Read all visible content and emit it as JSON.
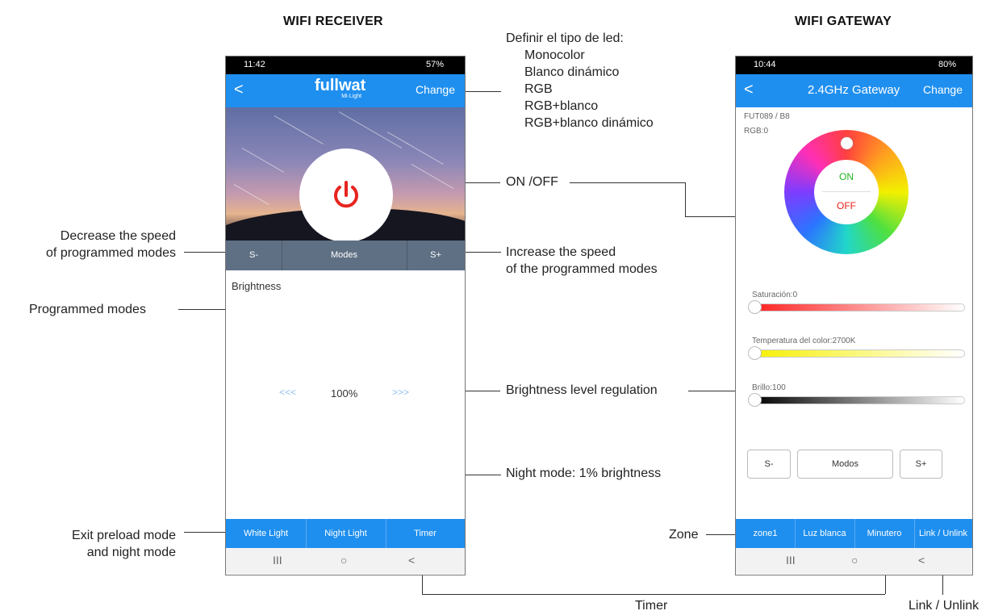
{
  "headings": {
    "left": "WIFI RECEIVER",
    "right": "WIFI GATEWAY"
  },
  "annotations": {
    "led_type_title": "Definir el tipo de led:",
    "led_types": [
      "Monocolor",
      "Blanco dinámico",
      "RGB",
      "RGB+blanco",
      "RGB+blanco dinámico"
    ],
    "on_off": "ON /OFF",
    "decrease_speed_1": "Decrease the speed",
    "decrease_speed_2": "of programmed modes",
    "increase_speed_1": "Increase the speed",
    "increase_speed_2": "of the programmed modes",
    "programmed_modes": "Programmed modes",
    "brightness_regulation": "Brightness level regulation",
    "night_mode": "Night mode: 1% brightness",
    "exit_preload_1": "Exit preload mode",
    "exit_preload_2": "and night mode",
    "zone": "Zone",
    "timer": "Timer",
    "link_unlink": "Link / Unlink"
  },
  "receiver": {
    "status_time": "11:42",
    "status_right": "57%",
    "logo": "fullwat",
    "logo_sub": "Mi·Light",
    "back": "<",
    "change": "Change",
    "modebar": {
      "s_minus": "S-",
      "modes": "Modes",
      "s_plus": "S+"
    },
    "brightness_label": "Brightness",
    "brightness_value": "100%",
    "arrow_left": "<<<",
    "arrow_right": ">>>",
    "bottom": {
      "white_light": "White Light",
      "night_light": "Night Light",
      "timer": "Timer"
    },
    "nav": {
      "recents": "III",
      "home": "○",
      "back": "<"
    },
    "colors": {
      "accent": "#1f8fef",
      "modebar": "#5f7084",
      "power": "#e8231e"
    }
  },
  "gateway": {
    "status_time": "10:44",
    "status_right": "80%",
    "back": "<",
    "title": "2.4GHz Gateway",
    "change": "Change",
    "device": "FUT089 / B8",
    "rgb": "RGB:0",
    "on": "ON",
    "off": "OFF",
    "saturation_label": "Saturación:0",
    "temperature_label": "Temperatura del color:2700K",
    "brightness_label": "Brillo:100",
    "buttons": {
      "s_minus": "S-",
      "modos": "Modos",
      "s_plus": "S+"
    },
    "bottom": {
      "zone": "zone1",
      "white": "Luz blanca",
      "timer": "Minutero",
      "link": "Link / Unlink"
    },
    "nav": {
      "recents": "III",
      "home": "○",
      "back": "<"
    },
    "colors": {
      "on": "#21b521",
      "off": "#e8231e"
    }
  }
}
